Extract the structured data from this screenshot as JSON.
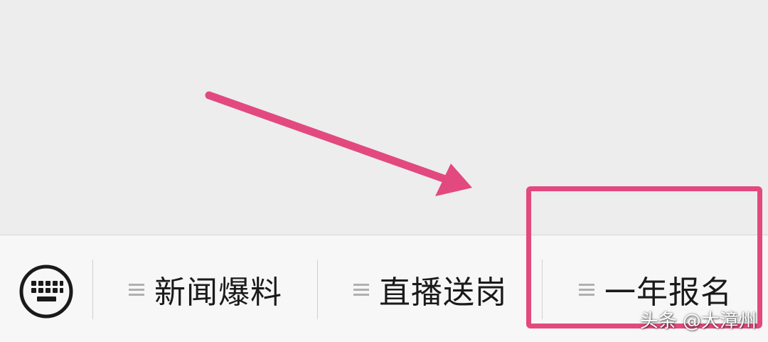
{
  "menu": {
    "items": [
      {
        "label": "新闻爆料",
        "icon": "lines-icon"
      },
      {
        "label": "直播送岗",
        "icon": "lines-icon"
      },
      {
        "label": "一年报名",
        "icon": "lines-icon"
      }
    ],
    "keyboard_icon": "keyboard-icon"
  },
  "annotation": {
    "color": "#e2497f",
    "highlighted_item": "一年报名"
  },
  "watermark": "头条 @大漳州",
  "colors": {
    "background": "#ededed",
    "menu_background": "#f7f7f7",
    "text": "#1a1a1a",
    "icon_gray": "#b0b0b0"
  }
}
